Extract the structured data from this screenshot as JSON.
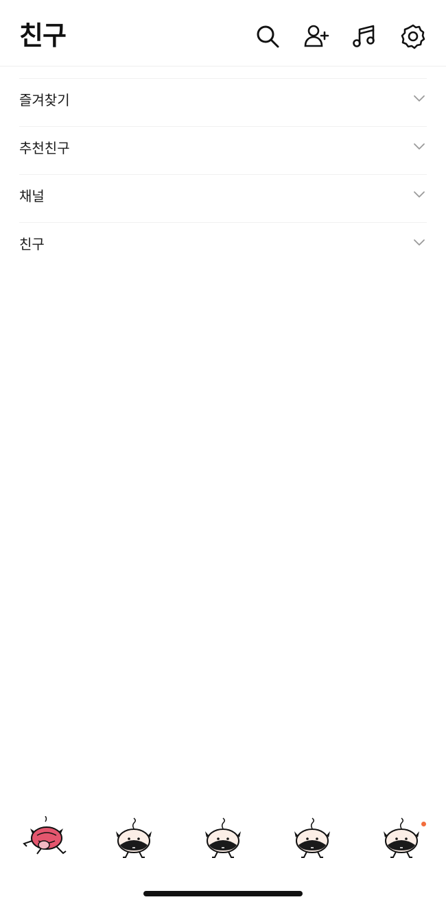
{
  "header": {
    "title": "친구",
    "icons": [
      "search-icon",
      "add-friend-icon",
      "music-icon",
      "settings-icon"
    ]
  },
  "sections": [
    {
      "label": "즐겨찾기"
    },
    {
      "label": "추천친구"
    },
    {
      "label": "채널"
    },
    {
      "label": "친구"
    }
  ],
  "bottom_tabs": [
    {
      "name": "friends-tab",
      "icon": "character-red-icon",
      "active": true
    },
    {
      "name": "chats-tab",
      "icon": "character-icon",
      "active": false
    },
    {
      "name": "view-tab",
      "icon": "character-icon",
      "active": false
    },
    {
      "name": "shopping-tab",
      "icon": "character-icon",
      "active": false
    },
    {
      "name": "more-tab",
      "icon": "character-icon",
      "active": false,
      "badge": true
    }
  ],
  "colors": {
    "text": "#111111",
    "divider": "#f0f0f0",
    "chevron": "#9a9a9a",
    "badge": "#f26d3d",
    "active_character": "#e4566e"
  }
}
